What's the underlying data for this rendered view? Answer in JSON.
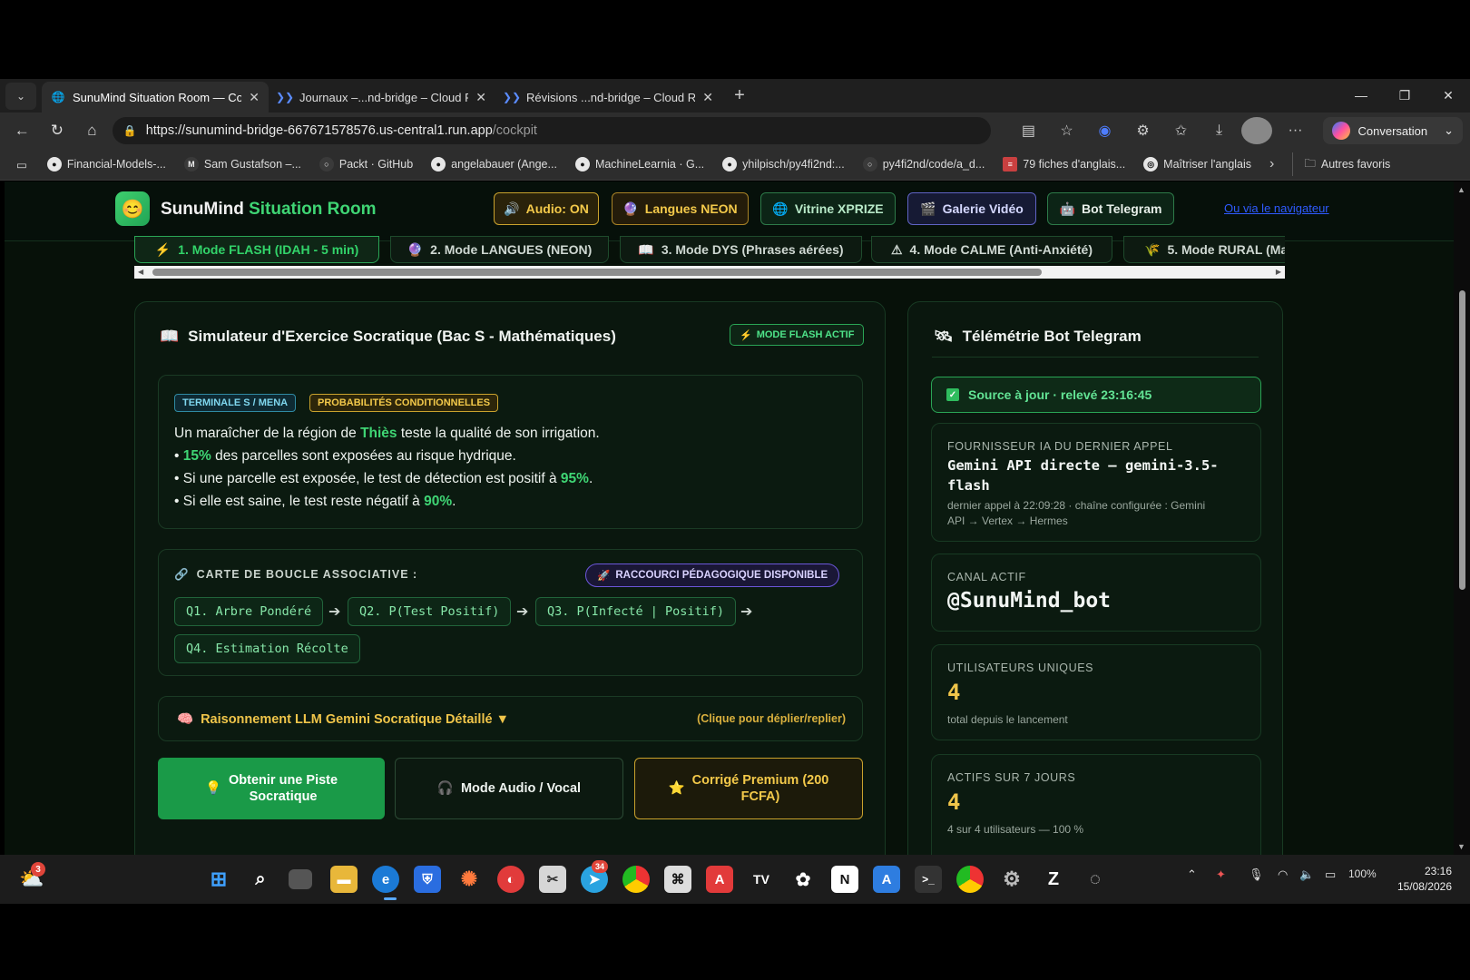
{
  "browser": {
    "tabs": [
      {
        "title": "SunuMind Situation Room — Cock",
        "active": true
      },
      {
        "title": "Journaux –...nd-bridge – Cloud Ru",
        "active": false
      },
      {
        "title": "Révisions ...nd-bridge – Cloud Run",
        "active": false
      }
    ],
    "url_host": "https://sunumind-bridge-667671578576.us-central1.run.app",
    "url_path": "/cockpit",
    "copilot_label": "Conversation",
    "bookmarks": [
      {
        "label": "Financial-Models-...",
        "icon": "github-icon"
      },
      {
        "label": "Sam Gustafson –...",
        "icon": "mk-icon"
      },
      {
        "label": "Packt · GitHub",
        "icon": "packt-icon"
      },
      {
        "label": "angelabauer (Ange...",
        "icon": "github-icon"
      },
      {
        "label": "MachineLearnia · G...",
        "icon": "github-icon"
      },
      {
        "label": "yhilpisch/py4fi2nd:...",
        "icon": "github-icon"
      },
      {
        "label": "py4fi2nd/code/a_d...",
        "icon": "github-icon"
      },
      {
        "label": "79 fiches d'anglais...",
        "icon": "doc-icon"
      },
      {
        "label": "Maîtriser l'anglais",
        "icon": "globe-icon"
      }
    ],
    "other_favorites": "Autres favoris"
  },
  "header": {
    "logo_emoji": "😊",
    "brand_part1": "SunuMind",
    "brand_part2": "Situation Room",
    "nav": [
      {
        "label": "Audio: ON",
        "icon": "🔊"
      },
      {
        "label": "Langues NEON",
        "icon": "🔮"
      },
      {
        "label": "Vitrine XPRIZE",
        "icon": "🌐"
      },
      {
        "label": "Galerie Vidéo",
        "icon": "🎬"
      },
      {
        "label": "Bot Telegram",
        "icon": "🤖"
      }
    ],
    "link": "Ou via le navigateur"
  },
  "modes": [
    {
      "label": "1. Mode FLASH (IDAH - 5 min)",
      "icon": "⚡",
      "active": true
    },
    {
      "label": "2. Mode LANGUES (NEON)",
      "icon": "🔮",
      "active": false
    },
    {
      "label": "3. Mode DYS (Phrases aérées)",
      "icon": "📖",
      "active": false
    },
    {
      "label": "4. Mode CALME (Anti-Anxiété)",
      "icon": "⚠",
      "active": false
    },
    {
      "label": "5. Mode RURAL (Ma",
      "icon": "🌾",
      "active": false
    }
  ],
  "simulator": {
    "title": "Simulateur d'Exercice Socratique (Bac S - Mathématiques)",
    "title_icon": "📖",
    "badge": "MODE FLASH ACTIF",
    "tags": [
      "TERMINALE S / MENA",
      "PROBABILITÉS CONDITIONNELLES"
    ],
    "exercise": {
      "l1_a": "Un maraîcher de la région de ",
      "l1_hl": "Thiès",
      "l1_b": " teste la qualité de son irrigation.",
      "l2_bullet": "• ",
      "l2_hl": "15%",
      "l2_b": " des parcelles sont exposées au risque hydrique.",
      "l3_a": "• Si une parcelle est exposée, le test de détection est positif à ",
      "l3_hl": "95%",
      "l3_b": ".",
      "l4_a": "• Si elle est saine, le test reste négatif à ",
      "l4_hl": "90%",
      "l4_b": "."
    },
    "loop_map": {
      "label": "CARTE DE BOUCLE ASSOCIATIVE :",
      "shortcut": "RACCOURCI PÉDAGOGIQUE DISPONIBLE",
      "steps": [
        "Q1. Arbre Pondéré",
        "Q2. P(Test Positif)",
        "Q3. P(Infecté | Positif)",
        "Q4. Estimation Récolte"
      ],
      "arrow": "➔"
    },
    "reasoning": {
      "title": "Raisonnement LLM Gemini Socratique Détaillé ▼",
      "hint": "(Clique pour déplier/replier)"
    },
    "actions": {
      "hint_l1": "Obtenir une Piste",
      "hint_l2": "Socratique",
      "audio": "Mode Audio / Vocal",
      "premium_l1": "Corrigé Premium (200",
      "premium_l2": "FCFA)"
    }
  },
  "telemetry": {
    "title": "Télémétrie Bot Telegram",
    "source": "Source à jour · relevé 23:16:45",
    "provider_label": "FOURNISSEUR IA DU DERNIER APPEL",
    "provider_l1": "Gemini API directe — gemini-3.5-",
    "provider_l2": "flash",
    "provider_sub_l1": "dernier appel à 22:09:28 · chaîne configurée : Gemini",
    "provider_sub_l2": "API → Vertex → Hermes",
    "channel_label": "CANAL ACTIF",
    "channel": "@SunuMind_bot",
    "users_label": "UTILISATEURS UNIQUES",
    "users": "4",
    "users_sub": "total depuis le lancement",
    "active_label": "ACTIFS SUR 7 JOURS",
    "active": "4",
    "active_sub": "4 sur 4 utilisateurs — 100 %"
  },
  "taskbar": {
    "weather_badge": "3",
    "telegram_badge": "34",
    "battery": "100%",
    "time": "23:16",
    "date": "15/08/2026"
  },
  "colors": {
    "accent_green": "#3fd574",
    "accent_yellow": "#f0c54a",
    "page_bg": "#071109"
  }
}
